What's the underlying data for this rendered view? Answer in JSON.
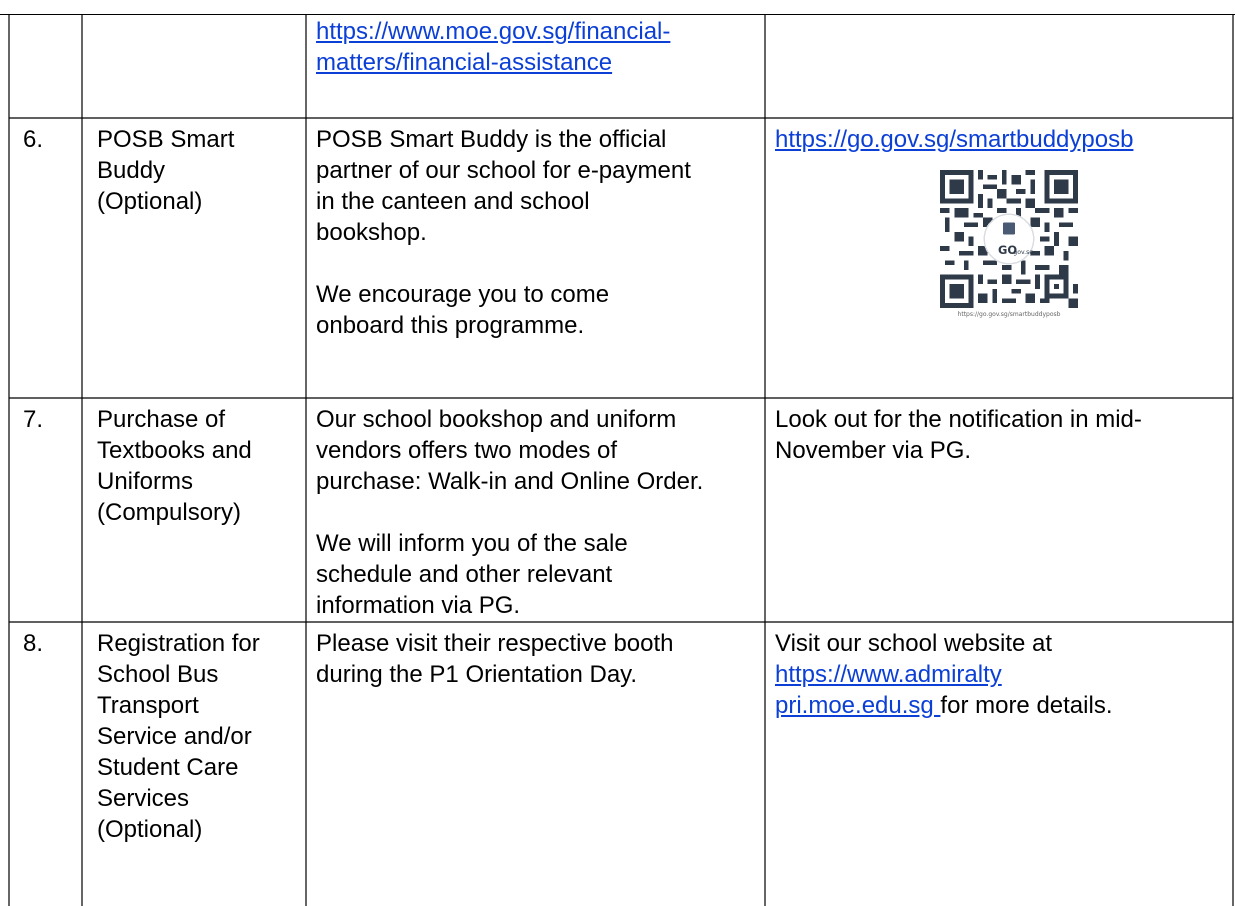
{
  "top_row": {
    "link_line1": "https://www.moe.gov.sg/financial-",
    "link_line2": "matters/financial-assistance"
  },
  "rows": [
    {
      "number": "6.",
      "item_lines": [
        "POSB Smart",
        "Buddy",
        "(Optional)"
      ],
      "desc_para1": [
        "POSB Smart Buddy is the official",
        "partner of our school for e-payment",
        "in the canteen and school",
        "bookshop."
      ],
      "desc_para2": [
        "We encourage you to come",
        "onboard this programme."
      ],
      "link": "https://go.gov.sg/smartbuddyposb",
      "qr_logo_text": "GO",
      "qr_logo_sub": "gov.sg",
      "qr_caption": "https://go.gov.sg/smartbuddyposb"
    },
    {
      "number": "7.",
      "item_lines": [
        "Purchase of",
        "Textbooks and",
        "Uniforms",
        "(Compulsory)"
      ],
      "desc_para1": [
        "Our school bookshop and uniform",
        "vendors offers two modes of",
        "purchase: Walk-in and Online Order."
      ],
      "desc_para2": [
        "We will inform you of the sale",
        "schedule and other relevant",
        "information via PG."
      ],
      "details_lines": [
        "Look out for the notification in mid-",
        "November via PG."
      ]
    },
    {
      "number": "8.",
      "item_lines": [
        "Registration for",
        "School Bus",
        "Transport",
        "Service and/or",
        "Student Care",
        "Services",
        "(Optional)"
      ],
      "desc_para1": [
        "Please visit their respective booth",
        "during the P1 Orientation Day."
      ],
      "details_prefix": "Visit our school website at",
      "details_link_line1": "https://www.admiralty",
      "details_link_line2": "pri.moe.edu.sg ",
      "details_suffix": "for more details."
    }
  ]
}
